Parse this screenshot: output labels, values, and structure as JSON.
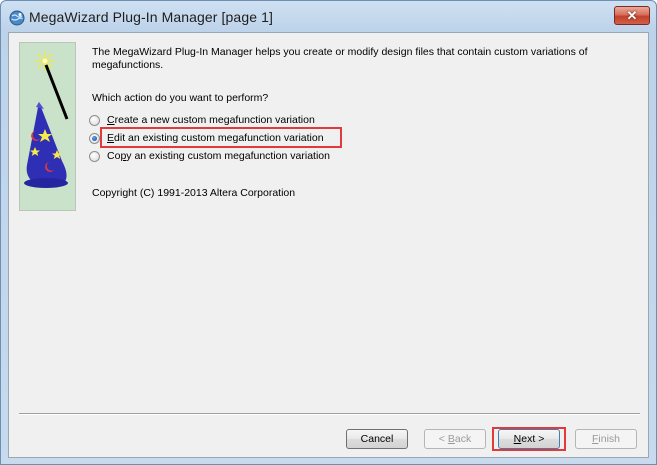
{
  "window": {
    "title": "MegaWizard Plug-In Manager [page 1]",
    "close_label": "✕"
  },
  "main": {
    "intro": "The MegaWizard Plug-In Manager helps you create or modify design files that contain custom variations of megafunctions.",
    "question": "Which action do you want to perform?",
    "options": [
      {
        "pre": "",
        "mnemonic": "C",
        "post": "reate a new custom megafunction variation",
        "checked": false
      },
      {
        "pre": "",
        "mnemonic": "E",
        "post": "dit an existing custom megafunction variation",
        "checked": true
      },
      {
        "pre": "Co",
        "mnemonic": "p",
        "post": "y an existing custom megafunction variation",
        "checked": false
      }
    ],
    "copyright": "Copyright (C) 1991-2013 Altera Corporation"
  },
  "buttons": {
    "cancel": "Cancel",
    "back_pre": "< ",
    "back_mnemonic": "B",
    "back_post": "ack",
    "next_mnemonic": "N",
    "next_post": "ext >",
    "finish_mnemonic": "F",
    "finish_post": "inish"
  },
  "colors": {
    "highlight": "#e23a3a",
    "wizard_panel": "#c9e2c9"
  },
  "icons": {
    "app": "globe-icon",
    "wizard": "wizard-hat-icon"
  }
}
